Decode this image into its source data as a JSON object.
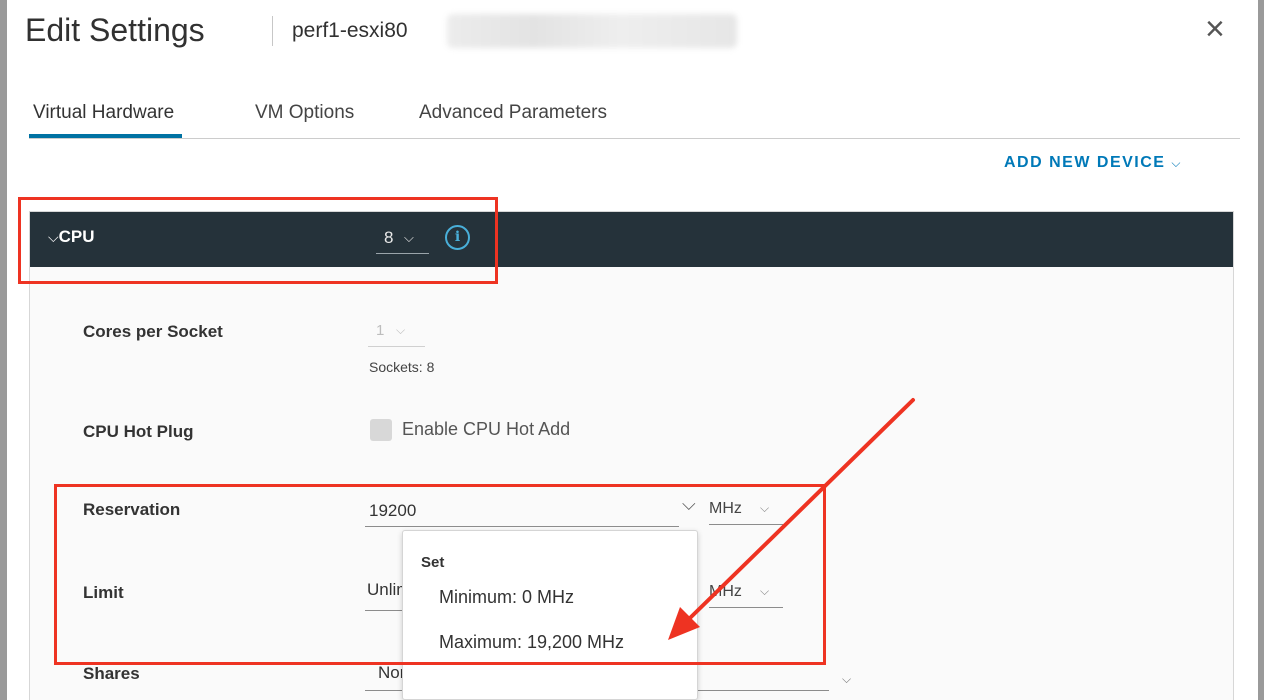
{
  "dialog": {
    "title": "Edit Settings",
    "subtitle": "perf1-esxi80",
    "close_glyph": "×"
  },
  "tabs": [
    {
      "label": "Virtual Hardware",
      "active": true
    },
    {
      "label": "VM Options",
      "active": false
    },
    {
      "label": "Advanced Parameters",
      "active": false
    }
  ],
  "toolbar": {
    "add_device_label": "ADD NEW DEVICE",
    "chevron_glyph": "⌵"
  },
  "cpu": {
    "label": "CPU",
    "toggle_glyph": "⌵",
    "count": "8",
    "info_glyph": "i",
    "cores_per_socket_label": "Cores per Socket",
    "cores_per_socket_value": "1",
    "sockets_text": "Sockets: 8",
    "hot_plug_label": "CPU Hot Plug",
    "hot_add_checkbox_label": "Enable CPU Hot Add",
    "hot_add_checked": false,
    "reservation_label": "Reservation",
    "reservation_value": "19200",
    "reservation_unit": "MHz",
    "limit_label": "Limit",
    "limit_value": "Unlimited",
    "limit_unit": "MHz",
    "shares_label": "Shares",
    "shares_value": "Normal"
  },
  "popover": {
    "header": "Set",
    "minimum": "Minimum: 0 MHz",
    "maximum": "Maximum: 19,200 MHz"
  },
  "colors": {
    "accent": "#0079b8",
    "header_bar": "#25323a",
    "annotation": "#ee3322"
  }
}
